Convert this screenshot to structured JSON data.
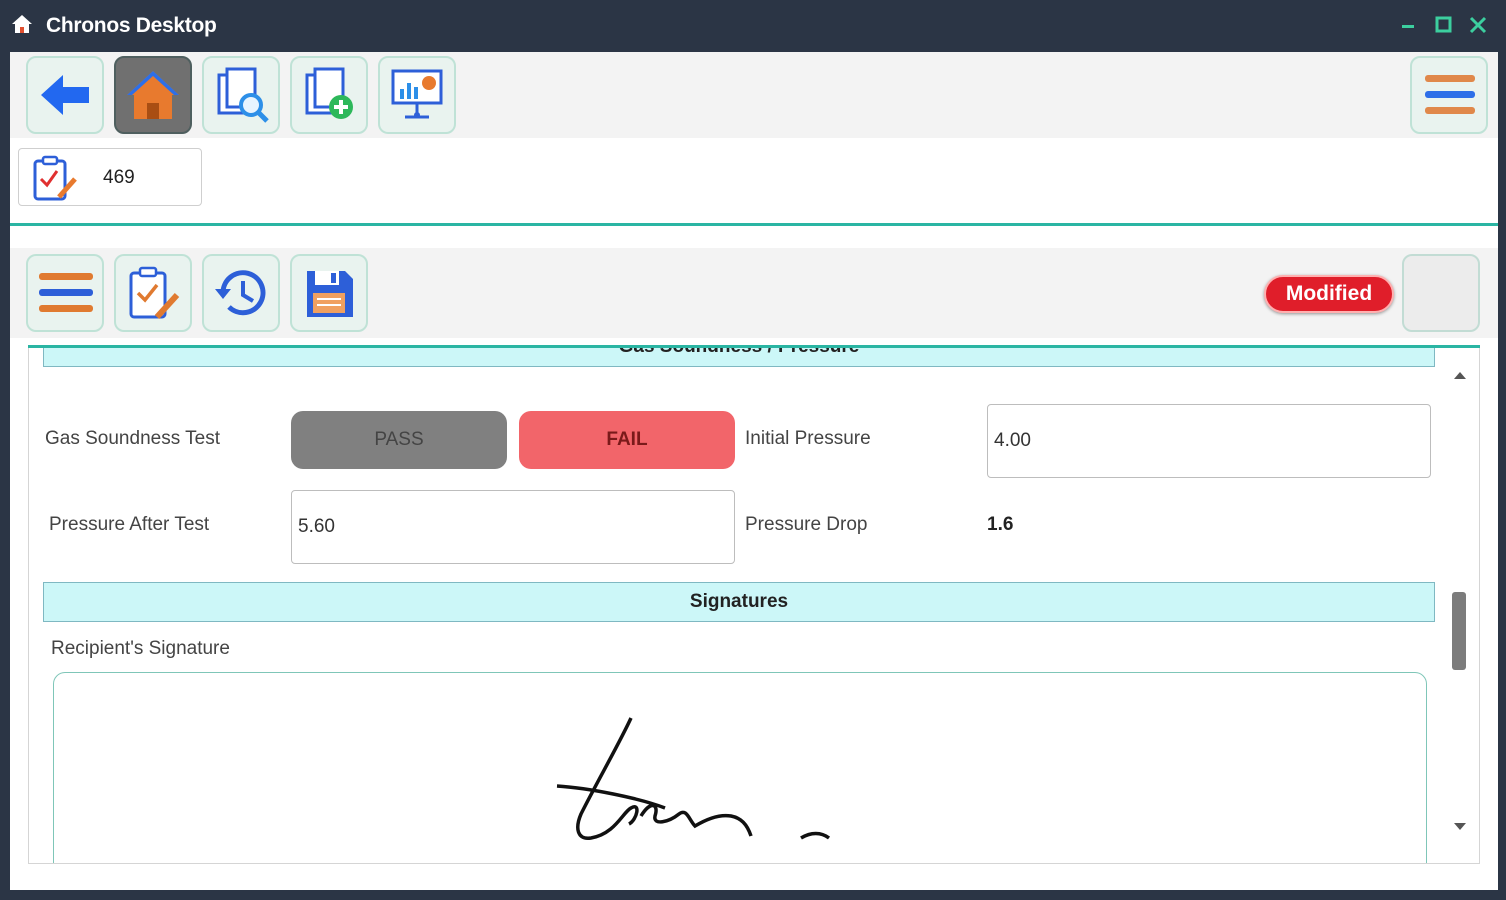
{
  "window": {
    "title": "Chronos Desktop"
  },
  "toolbar": {
    "icons": [
      "back-arrow-icon",
      "home-icon",
      "search-documents-icon",
      "add-document-icon",
      "dashboard-presentation-icon",
      "hamburger-menu-icon"
    ]
  },
  "job": {
    "number": "469"
  },
  "form_toolbar": {
    "icons": [
      "menu-icon",
      "checklist-edit-icon",
      "history-icon",
      "save-icon"
    ],
    "status_badge": "Modified"
  },
  "gas_section": {
    "title": "Gas Soundness / Pressure",
    "soundness_label": "Gas Soundness Test",
    "pass_label": "PASS",
    "fail_label": "FAIL",
    "selected": "FAIL",
    "initial_pressure_label": "Initial Pressure",
    "initial_pressure_value": "4.00",
    "pressure_after_label": "Pressure After Test",
    "pressure_after_value": "5.60",
    "pressure_drop_label": "Pressure Drop",
    "pressure_drop_value": "1.6"
  },
  "signatures": {
    "title": "Signatures",
    "recipient_label": "Recipient's Signature"
  },
  "colors": {
    "titlebar": "#2b3545",
    "accent_teal": "#2ab5a3",
    "fail_red": "#f2656a",
    "modified_red": "#e01e2a",
    "section_header": "#ccf7f8"
  }
}
